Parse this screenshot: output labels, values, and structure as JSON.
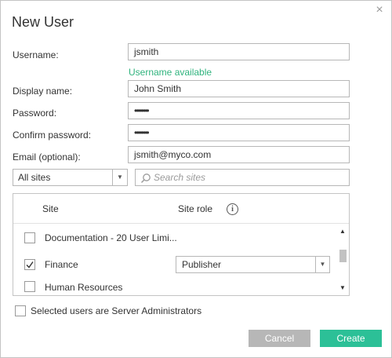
{
  "dialog": {
    "title": "New User",
    "close_glyph": "×"
  },
  "form": {
    "username_label": "Username:",
    "username_value": "jsmith",
    "username_status": "Username available",
    "display_name_label": "Display name:",
    "display_name_value": "John Smith",
    "password_label": "Password:",
    "password_value": "••••••••",
    "confirm_password_label": "Confirm password:",
    "confirm_password_value": "••••••••",
    "email_label": "Email (optional):",
    "email_value": "jsmith@myco.com"
  },
  "filter": {
    "site_filter_value": "All sites",
    "search_placeholder": "Search sites"
  },
  "table": {
    "headers": {
      "site": "Site",
      "site_role": "Site role"
    },
    "rows": [
      {
        "site": "Documentation - 20 User Limi...",
        "checked": false,
        "role": ""
      },
      {
        "site": "Finance",
        "checked": true,
        "role": "Publisher"
      },
      {
        "site": "Human Resources",
        "checked": false,
        "role": ""
      }
    ]
  },
  "admin": {
    "label": "Selected users are Server Administrators",
    "checked": false
  },
  "buttons": {
    "cancel": "Cancel",
    "create": "Create"
  },
  "colors": {
    "accent_green": "#2cc097",
    "available_text": "#2fb37d",
    "cancel_gray": "#b7b7b7"
  },
  "icons": {
    "close": "close-icon",
    "search": "search-icon",
    "info": "info-icon",
    "dropdown": "chevron-down-icon",
    "check": "checkmark-icon"
  }
}
